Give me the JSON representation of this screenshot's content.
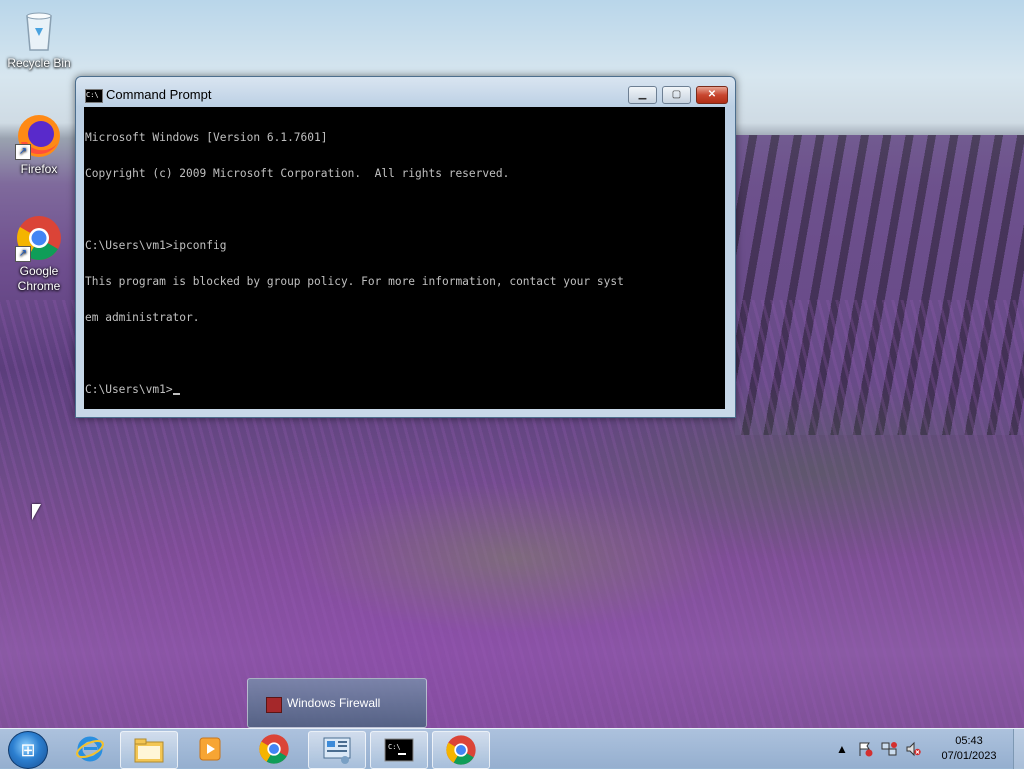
{
  "desktop": {
    "icons": [
      {
        "label": "Recycle Bin"
      },
      {
        "label": "Firefox"
      },
      {
        "label": "Google Chrome"
      }
    ]
  },
  "cmd_window": {
    "title": "Command Prompt",
    "lines": [
      "Microsoft Windows [Version 6.1.7601]",
      "Copyright (c) 2009 Microsoft Corporation.  All rights reserved.",
      "",
      "C:\\Users\\vm1>ipconfig",
      "This program is blocked by group policy. For more information, contact your syst",
      "em administrator.",
      "",
      "C:\\Users\\vm1>"
    ]
  },
  "popup": {
    "label": "Windows Firewall"
  },
  "taskbar": {
    "items": [
      {
        "name": "internet-explorer"
      },
      {
        "name": "file-explorer"
      },
      {
        "name": "media-player"
      },
      {
        "name": "google-chrome"
      },
      {
        "name": "control-panel"
      },
      {
        "name": "command-prompt"
      },
      {
        "name": "google-chrome-2"
      }
    ],
    "clock_time": "05:43",
    "clock_date": "07/01/2023"
  }
}
